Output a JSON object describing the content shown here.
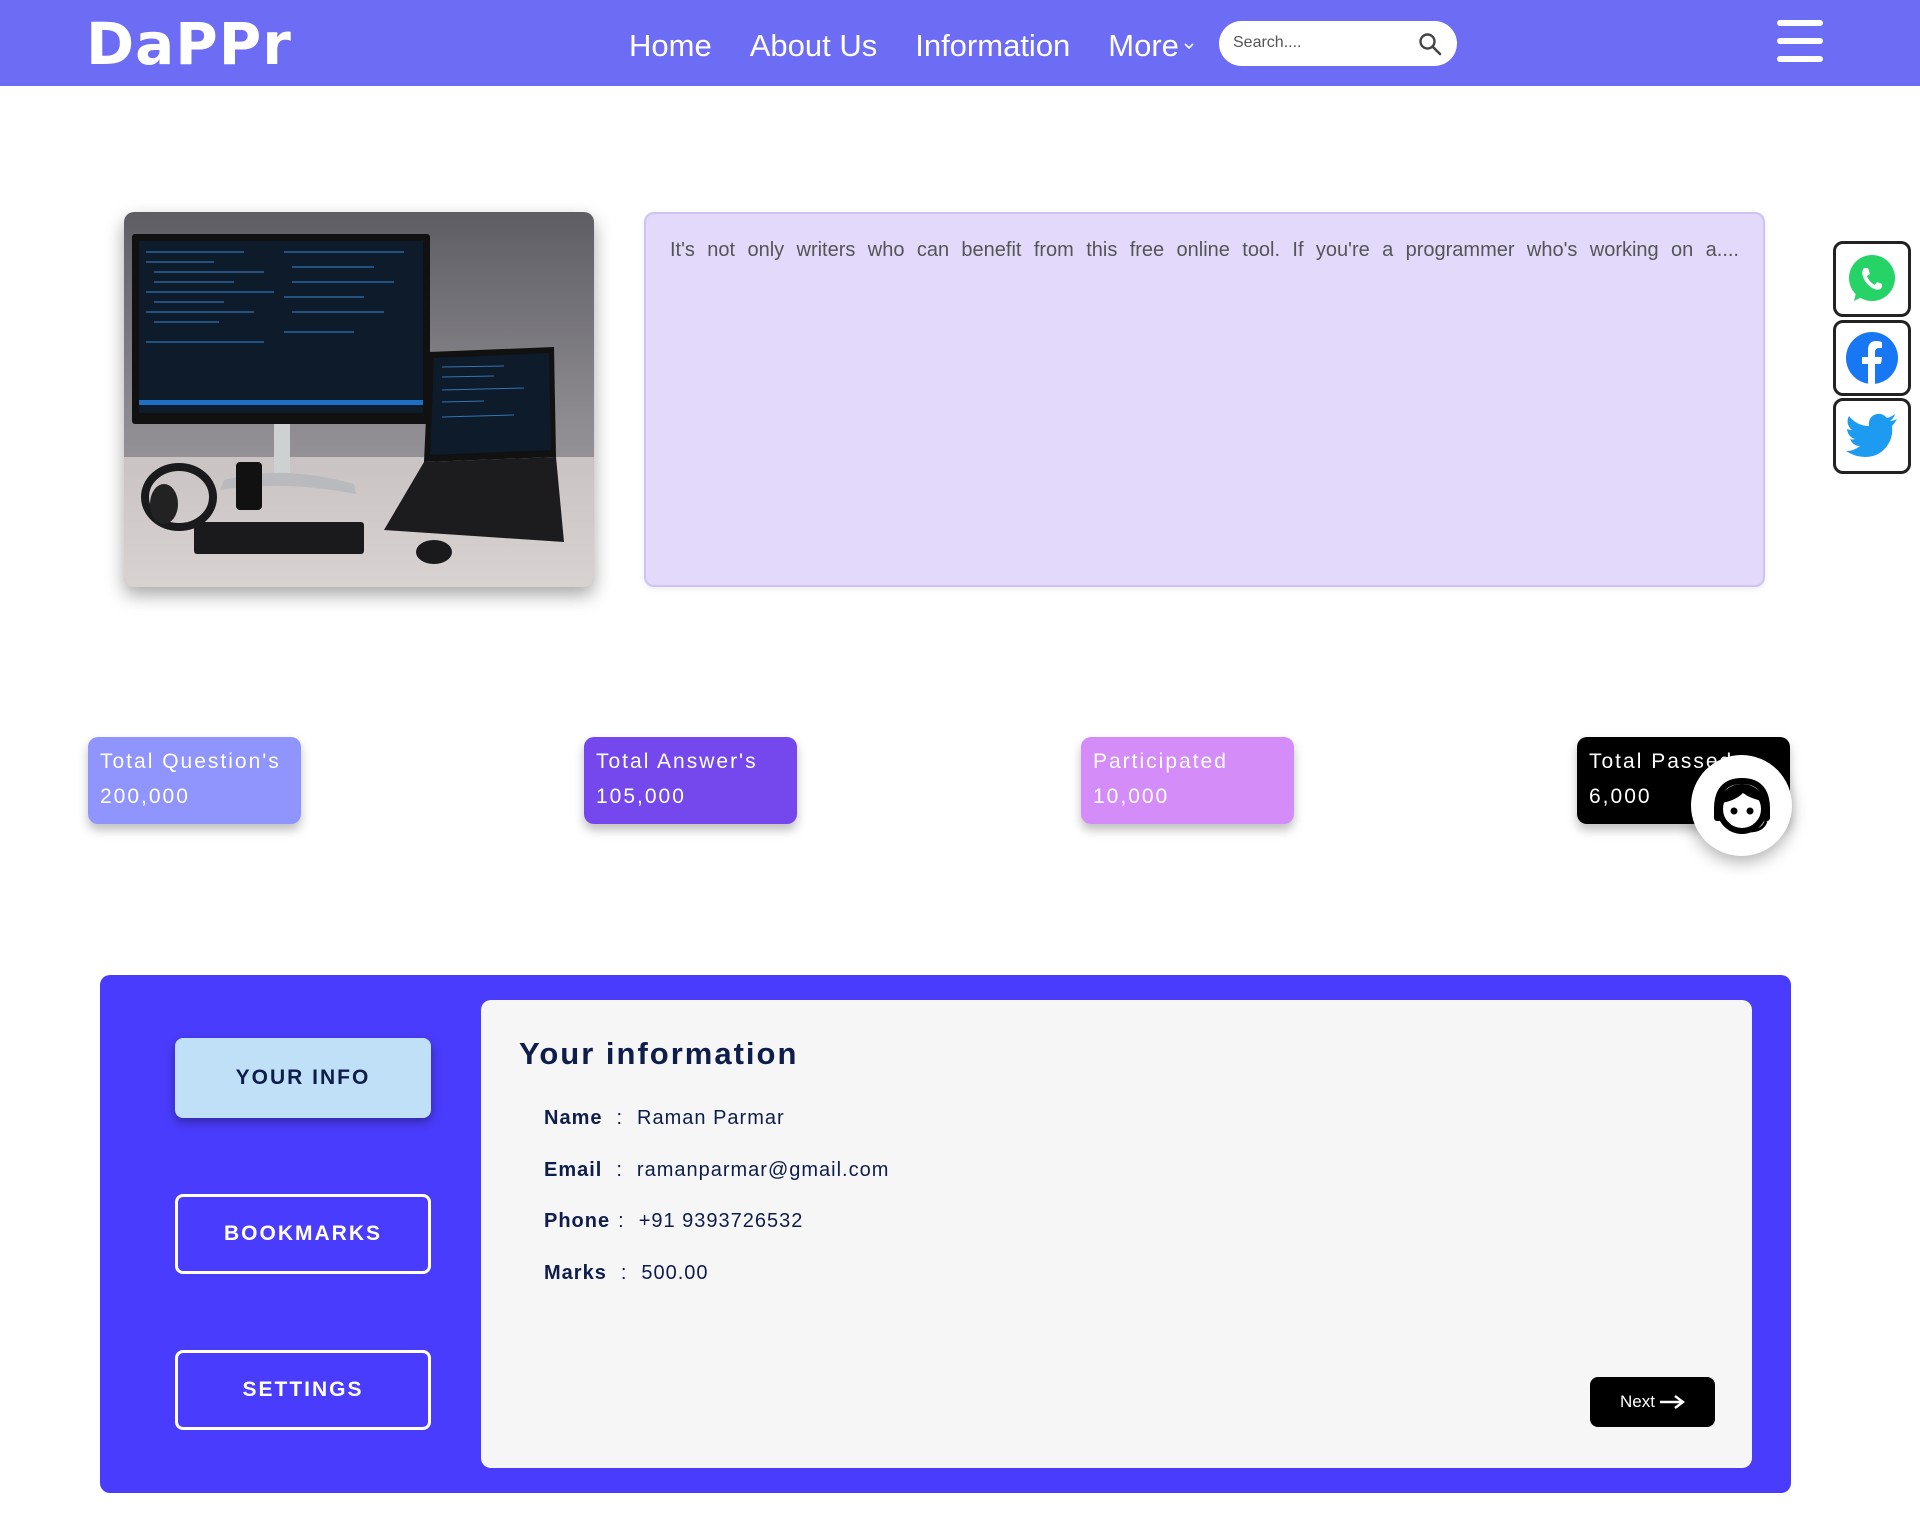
{
  "header": {
    "logo_text": "DaPPr",
    "nav": [
      {
        "label": "Home"
      },
      {
        "label": "About Us"
      },
      {
        "label": "Information"
      },
      {
        "label": "More"
      }
    ],
    "search_placeholder": "Search....",
    "brand_color": "#6c6cf4"
  },
  "hero": {
    "image_alt": "desk with monitor and laptop showing code",
    "text": "It's not only writers who can benefit from this free online tool. If you're a programmer who's working on a...."
  },
  "social": [
    {
      "name": "whatsapp-icon"
    },
    {
      "name": "facebook-icon"
    },
    {
      "name": "twitter-icon"
    }
  ],
  "stats": [
    {
      "label": "Total Question's",
      "value": "200,000",
      "color": "#8f95fd"
    },
    {
      "label": "Total Answer's",
      "value": "105,000",
      "color": "#7448ec"
    },
    {
      "label": "Participated",
      "value": "10,000",
      "color": "#d48cf9"
    },
    {
      "label": "Total Passed",
      "value": "6,000",
      "color": "#000000"
    }
  ],
  "profile": {
    "menu": [
      {
        "label": "YOUR INFO",
        "active": true
      },
      {
        "label": "BOOKMARKS",
        "active": false
      },
      {
        "label": "SETTINGS",
        "active": false
      }
    ],
    "title": "Your information",
    "fields": [
      {
        "key": "Name",
        "value": "Raman Parmar"
      },
      {
        "key": "Email",
        "value": "ramanparmar@gmail.com"
      },
      {
        "key": "Phone",
        "value": "+91 9393726532"
      },
      {
        "key": "Marks",
        "value": "500.00"
      }
    ],
    "next_label": "Next",
    "panel_color": "#4a3cfc"
  }
}
